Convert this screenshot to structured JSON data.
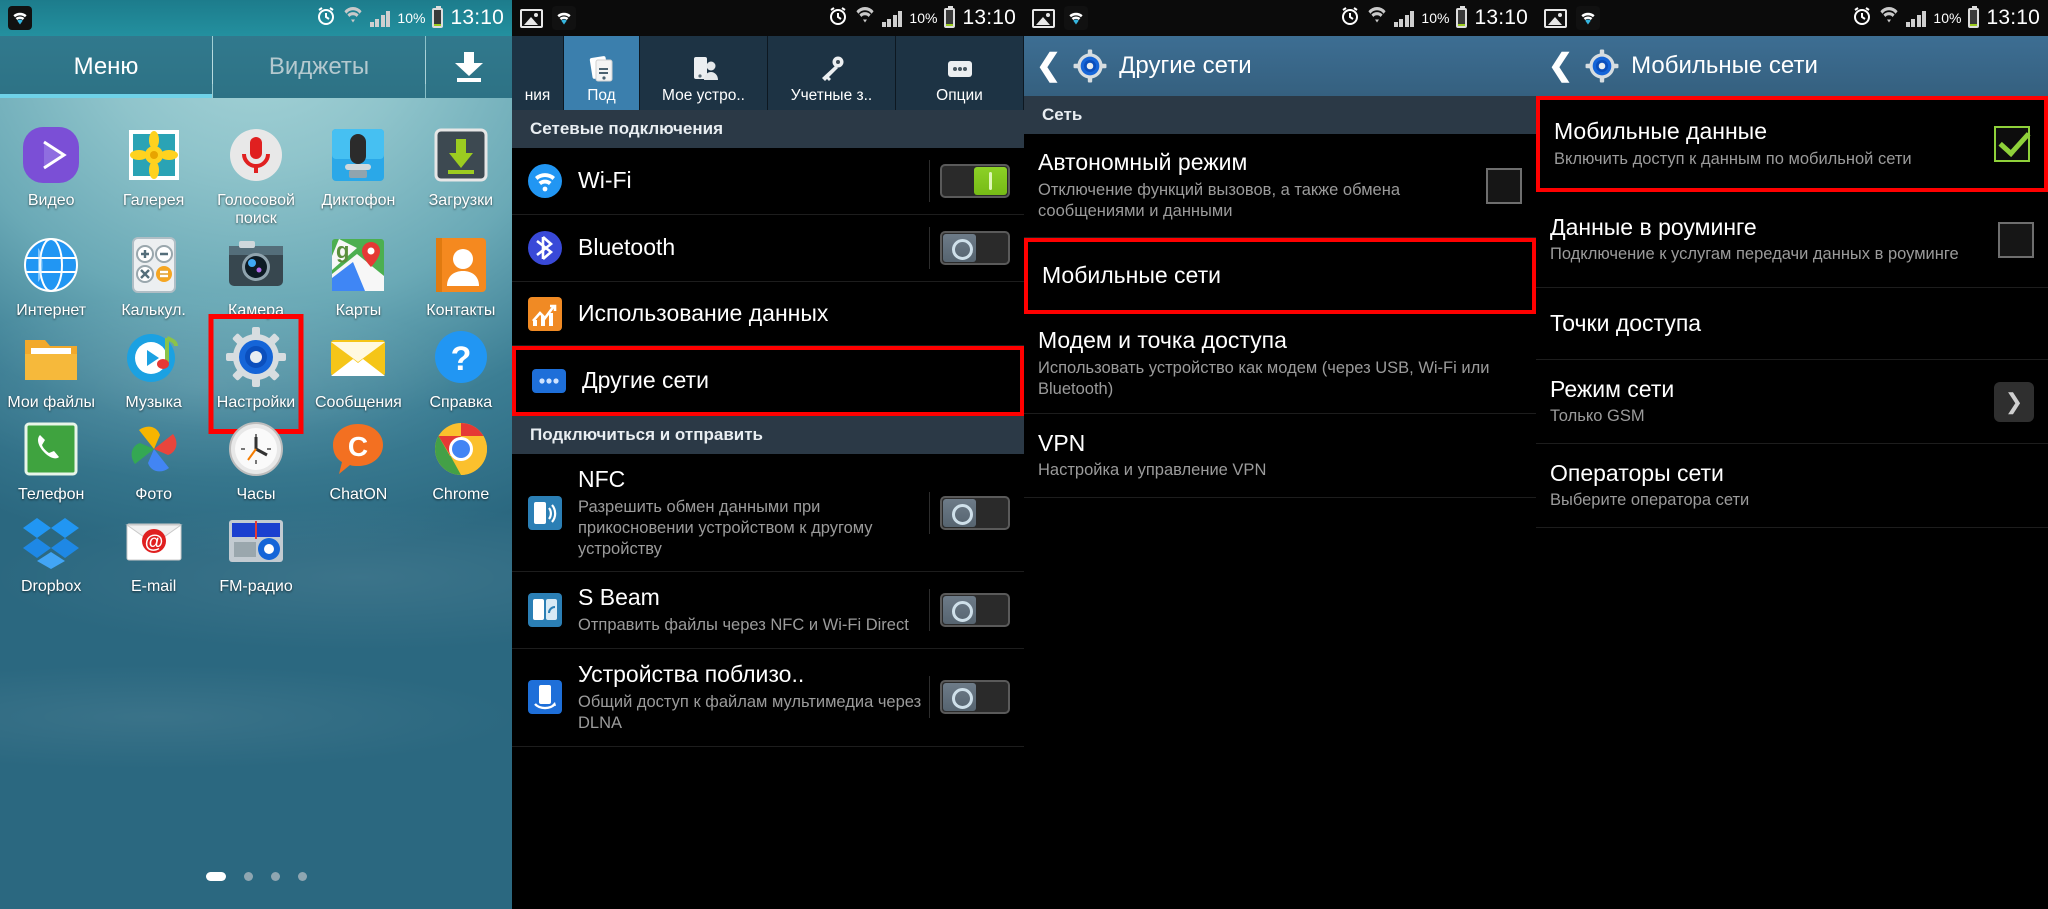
{
  "status_bar": {
    "time": "13:10",
    "battery_percent": "10%",
    "icons": [
      "alarm-icon",
      "wifi-icon",
      "signal-icon",
      "battery-icon",
      "screenshot-icon"
    ]
  },
  "screen1_home": {
    "tabs": [
      {
        "label": "Меню",
        "active": true
      },
      {
        "label": "Виджеты",
        "active": false
      }
    ],
    "download_button": "download-icon",
    "apps": [
      [
        {
          "label": "Видео",
          "icon": "video-player-icon"
        },
        {
          "label": "Галерея",
          "icon": "gallery-icon"
        },
        {
          "label": "Голосовой поиск",
          "icon": "voice-search-icon"
        },
        {
          "label": "Диктофон",
          "icon": "voice-recorder-icon"
        },
        {
          "label": "Загрузки",
          "icon": "downloads-icon"
        }
      ],
      [
        {
          "label": "Интернет",
          "icon": "internet-browser-icon"
        },
        {
          "label": "Калькул.",
          "icon": "calculator-icon"
        },
        {
          "label": "Камера",
          "icon": "camera-icon"
        },
        {
          "label": "Карты",
          "icon": "maps-icon"
        },
        {
          "label": "Контакты",
          "icon": "contacts-icon"
        }
      ],
      [
        {
          "label": "Мои файлы",
          "icon": "my-files-icon"
        },
        {
          "label": "Музыка",
          "icon": "music-icon"
        },
        {
          "label": "Настройки",
          "icon": "settings-gear-icon",
          "highlighted": true
        },
        {
          "label": "Сообщения",
          "icon": "messages-icon"
        },
        {
          "label": "Справка",
          "icon": "help-icon"
        }
      ],
      [
        {
          "label": "Телефон",
          "icon": "phone-icon"
        },
        {
          "label": "Фото",
          "icon": "photos-icon"
        },
        {
          "label": "Часы",
          "icon": "clock-icon"
        },
        {
          "label": "ChatON",
          "icon": "chaton-icon"
        },
        {
          "label": "Chrome",
          "icon": "chrome-icon"
        }
      ],
      [
        {
          "label": "Dropbox",
          "icon": "dropbox-icon"
        },
        {
          "label": "E-mail",
          "icon": "email-icon"
        },
        {
          "label": "FM-радио",
          "icon": "fm-radio-icon"
        }
      ]
    ],
    "page_dots": {
      "count": 4,
      "active_index": 0
    }
  },
  "screen2_settings": {
    "tabs": [
      {
        "label": "ния",
        "icon": "connections-partial-icon",
        "active": false
      },
      {
        "label": "Под",
        "icon": "connections-icon",
        "active": true
      },
      {
        "label": "Мое устро..",
        "icon": "my-device-icon",
        "active": false
      },
      {
        "label": "Учетные з..",
        "icon": "accounts-key-icon",
        "active": false
      },
      {
        "label": "Опции",
        "icon": "more-options-icon",
        "active": false
      }
    ],
    "sections": [
      {
        "header": "Сетевые подключения",
        "items": [
          {
            "title": "Wi-Fi",
            "subtitle": "",
            "icon": "wifi-icon",
            "control": "toggle",
            "state": "on"
          },
          {
            "title": "Bluetooth",
            "subtitle": "",
            "icon": "bluetooth-icon",
            "control": "toggle",
            "state": "off"
          },
          {
            "title": "Использование данных",
            "subtitle": "",
            "icon": "data-usage-icon",
            "control": "none"
          },
          {
            "title": "Другие сети",
            "subtitle": "",
            "icon": "other-networks-icon",
            "control": "none",
            "highlighted": true
          }
        ]
      },
      {
        "header": "Подключиться и отправить",
        "items": [
          {
            "title": "NFC",
            "subtitle": "Разрешить обмен данными при прикосновении устройством к другому устройству",
            "icon": "nfc-icon",
            "control": "toggle",
            "state": "off"
          },
          {
            "title": "S Beam",
            "subtitle": "Отправить файлы через NFC и Wi-Fi Direct",
            "icon": "s-beam-icon",
            "control": "toggle",
            "state": "off"
          },
          {
            "title": "Устройства поблизо..",
            "subtitle": "Общий доступ к файлам мультимедиа через DLNA",
            "icon": "nearby-devices-icon",
            "control": "toggle",
            "state": "off"
          }
        ]
      }
    ]
  },
  "screen3_other_networks": {
    "action_bar": {
      "title": "Другие сети",
      "back": "back-chevron-icon",
      "icon": "settings-gear-icon"
    },
    "section_header": "Сеть",
    "items": [
      {
        "title": "Автономный режим",
        "subtitle": "Отключение функций вызовов, а также обмена сообщениями и данными",
        "control": "checkbox",
        "state": "unchecked"
      },
      {
        "title": "Мобильные сети",
        "subtitle": "",
        "control": "none",
        "highlighted": true
      },
      {
        "title": "Модем и точка доступа",
        "subtitle": "Использовать устройство как модем (через USB, Wi-Fi или Bluetooth)",
        "control": "none"
      },
      {
        "title": "VPN",
        "subtitle": "Настройка и управление VPN",
        "control": "none"
      }
    ]
  },
  "screen4_mobile_networks": {
    "action_bar": {
      "title": "Мобильные сети",
      "back": "back-chevron-icon",
      "icon": "settings-gear-icon"
    },
    "items": [
      {
        "title": "Мобильные данные",
        "subtitle": "Включить доступ к данным по мобильной сети",
        "control": "checkbox",
        "state": "checked",
        "highlighted": true
      },
      {
        "title": "Данные в роуминге",
        "subtitle": "Подключение к услугам передачи данных в роуминге",
        "control": "checkbox",
        "state": "unchecked"
      },
      {
        "title": "Точки доступа",
        "subtitle": "",
        "control": "none"
      },
      {
        "title": "Режим сети",
        "subtitle": "Только GSM",
        "control": "chevron"
      },
      {
        "title": "Операторы сети",
        "subtitle": "Выберите оператора сети",
        "control": "none"
      }
    ]
  },
  "colors": {
    "highlight_red": "#ff0000",
    "accent_blue": "#3b7fad",
    "toggle_on_green": "#8cd126",
    "checkbox_green": "#8fd13a"
  }
}
